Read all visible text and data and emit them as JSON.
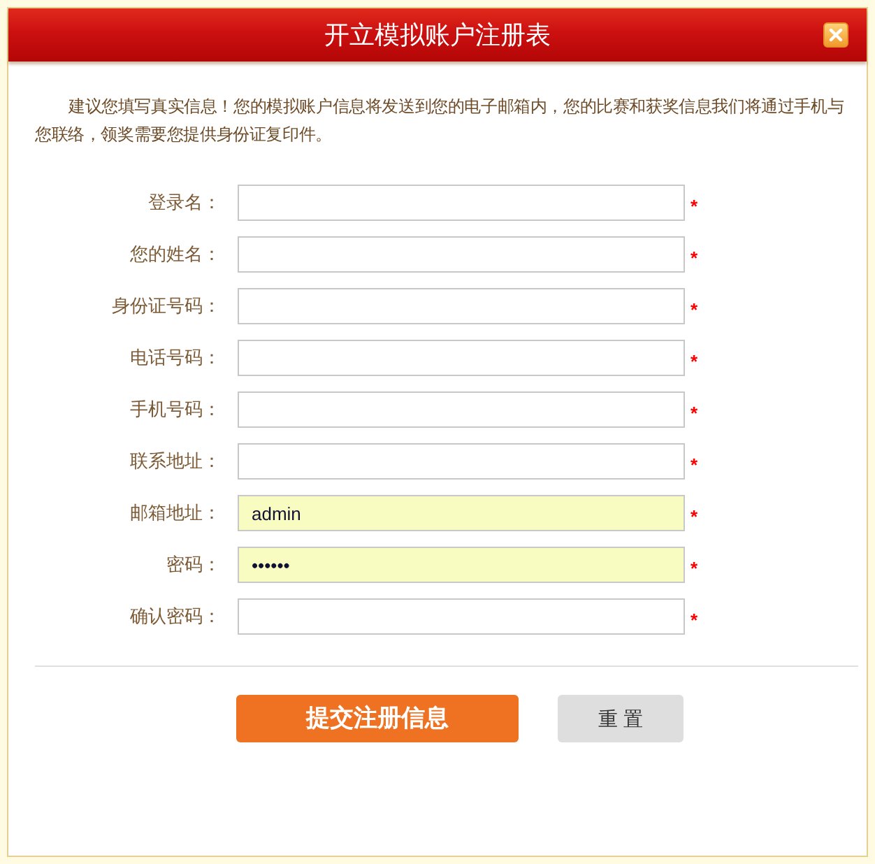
{
  "dialog": {
    "title": "开立模拟账户注册表"
  },
  "intro": "建议您填写真实信息！您的模拟账户信息将发送到您的电子邮箱内，您的比赛和获奖信息我们将通过手机与您联络，领奖需要您提供身份证复印件。",
  "fields": [
    {
      "label": "登录名：",
      "autofilled": false,
      "required_mark": "*"
    },
    {
      "label": "您的姓名：",
      "autofilled": false,
      "required_mark": "*"
    },
    {
      "label": "身份证号码：",
      "autofilled": false,
      "required_mark": "*"
    },
    {
      "label": "电话号码：",
      "autofilled": false,
      "required_mark": "*"
    },
    {
      "label": "手机号码：",
      "autofilled": false,
      "required_mark": "*"
    },
    {
      "label": "联系地址：",
      "autofilled": false,
      "required_mark": "*"
    },
    {
      "label": "邮箱地址：",
      "value": "admin",
      "autofilled": true,
      "required_mark": "*"
    },
    {
      "label": "密码：",
      "value": "••••••",
      "autofilled": true,
      "required_mark": "*"
    },
    {
      "label": "确认密码：",
      "autofilled": false,
      "required_mark": "*"
    }
  ],
  "buttons": [
    {
      "label": "提交注册信息",
      "kind": "primary"
    },
    {
      "label": "重 置",
      "kind": "secondary"
    }
  ]
}
